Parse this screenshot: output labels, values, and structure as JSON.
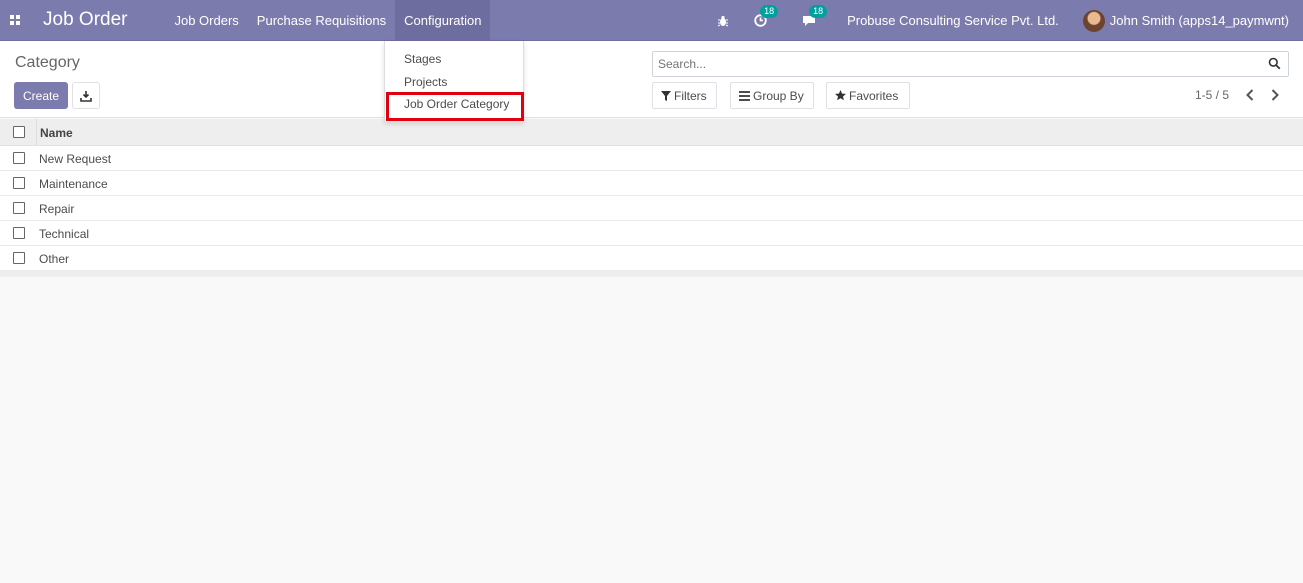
{
  "navbar": {
    "brand": "Job Order",
    "menu": [
      "Job Orders",
      "Purchase Requisitions",
      "Configuration"
    ],
    "activity_badge": "18",
    "messages_badge": "18",
    "company": "Probuse Consulting Service Pvt. Ltd.",
    "user": "John Smith (apps14_paymwnt)"
  },
  "dropdown": {
    "items": [
      "Stages",
      "Projects",
      "Job Order Category"
    ],
    "highlighted": "Job Order Category"
  },
  "control": {
    "breadcrumb": "Category",
    "create_label": "Create",
    "search_placeholder": "Search...",
    "filters_label": "Filters",
    "groupby_label": "Group By",
    "favorites_label": "Favorites",
    "pager": "1-5 / 5"
  },
  "list": {
    "column": "Name",
    "rows": [
      "New Request",
      "Maintenance",
      "Repair",
      "Technical",
      "Other"
    ]
  },
  "colors": {
    "navbar": "#7c7bad",
    "badge": "#00a09d",
    "highlight": "#e0000f"
  }
}
